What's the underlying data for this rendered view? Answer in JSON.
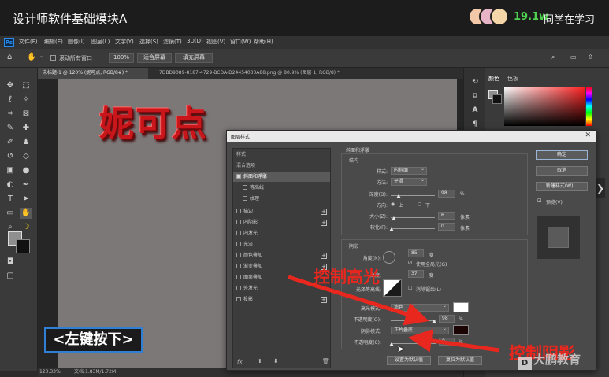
{
  "video": {
    "title": "设计师软件基础模块A",
    "learner_count": "19.1w",
    "learner_label": "同学在学习"
  },
  "menu": {
    "logo": "Ps",
    "items": [
      "文件(F)",
      "编辑(E)",
      "图像(I)",
      "图层(L)",
      "文字(Y)",
      "选择(S)",
      "滤镜(T)",
      "3D(D)",
      "视图(V)",
      "窗口(W)",
      "帮助(H)"
    ]
  },
  "options": {
    "scroll_all_label": "滚动所有窗口",
    "zoom_value": "100%",
    "fit_screen_label": "适合屏幕",
    "fill_screen_label": "填充屏幕"
  },
  "tabs": [
    {
      "label": "未标题-1 @ 120% (妮可点, RGB/8#) *",
      "active": true
    },
    {
      "label": "7DBD9089-8187-4729-BCDA-D24454030A88.png @ 80.9% (图层 1, RGB/8) *",
      "active": false
    }
  ],
  "canvas": {
    "doc_text": "妮可点",
    "hint_label": "<左键按下>"
  },
  "status": {
    "zoom": "120.33%",
    "doc_info": "文档:1.83M/1.72M"
  },
  "panel": {
    "color_tab": "颜色",
    "swatches_tab": "色板"
  },
  "dialog": {
    "title": "图层样式",
    "styles": [
      {
        "label": "样式",
        "kind": "header"
      },
      {
        "label": "混合选项",
        "kind": "header"
      },
      {
        "label": "斜面和浮雕",
        "kind": "item",
        "checked": true,
        "selected": true
      },
      {
        "label": "等高线",
        "kind": "sub"
      },
      {
        "label": "纹理",
        "kind": "sub"
      },
      {
        "label": "描边",
        "kind": "item",
        "plus": true
      },
      {
        "label": "内阴影",
        "kind": "item",
        "plus": true
      },
      {
        "label": "内发光",
        "kind": "item"
      },
      {
        "label": "光泽",
        "kind": "item"
      },
      {
        "label": "颜色叠加",
        "kind": "item",
        "plus": true
      },
      {
        "label": "渐变叠加",
        "kind": "item",
        "plus": true
      },
      {
        "label": "图案叠加",
        "kind": "item"
      },
      {
        "label": "外发光",
        "kind": "item"
      },
      {
        "label": "投影",
        "kind": "item",
        "plus": true
      }
    ],
    "list_footer": "fx.",
    "bevel_title": "斜面和浮雕",
    "structure_title": "结构",
    "style_label": "样式:",
    "style_value": "内斜面",
    "technique_label": "方法:",
    "technique_value": "平滑",
    "depth_label": "深度(D):",
    "depth_value": "98",
    "depth_unit": "%",
    "direction_label": "方向:",
    "direction_up": "上",
    "direction_down": "下",
    "size_label": "大小(Z):",
    "size_value": "6",
    "size_unit": "像素",
    "soften_label": "软化(F):",
    "soften_value": "0",
    "soften_unit": "像素",
    "shading_title": "阴影",
    "angle_label": "角度(N):",
    "angle_value": "85",
    "angle_unit": "度",
    "global_light_label": "使用全局光(G)",
    "altitude_label": "高度:",
    "altitude_value": "37",
    "altitude_unit": "度",
    "gloss_label": "光泽等高线:",
    "antialias_label": "消除锯齿(L)",
    "highlight_mode_label": "高光模式:",
    "highlight_mode_value": "滤色",
    "highlight_opacity_label": "不透明度(O):",
    "highlight_opacity_value": "98",
    "shadow_mode_label": "阴影模式:",
    "shadow_mode_value": "正片叠底",
    "shadow_opacity_label": "不透明度(C):",
    "shadow_opacity_value": "0",
    "pct": "%",
    "set_default_btn": "设置为默认值",
    "reset_default_btn": "复位为默认值",
    "ok_btn": "确定",
    "cancel_btn": "取消",
    "new_style_btn": "新建样式(W)...",
    "preview_label": "预览(V)"
  },
  "annotations": {
    "highlight_note": "控制高光",
    "shadow_note": "控制阴影",
    "watermark": "大鹏教育",
    "accent_color": "#e8271e"
  }
}
